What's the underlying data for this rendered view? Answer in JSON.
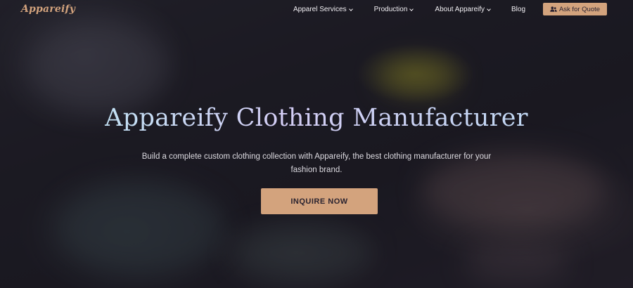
{
  "header": {
    "logo_text": "Appareify",
    "nav": [
      {
        "label": "Apparel Services",
        "has_dropdown": true
      },
      {
        "label": "Production",
        "has_dropdown": true
      },
      {
        "label": "About Appareify",
        "has_dropdown": true
      },
      {
        "label": "Blog",
        "has_dropdown": false
      }
    ],
    "quote_button": {
      "label": "Ask for Quote",
      "icon": "users-icon"
    }
  },
  "hero": {
    "title": "Appareify Clothing Manufacturer",
    "subtitle": "Build a complete custom clothing collection with Appareify, the best clothing manufacturer for your fashion brand.",
    "cta_label": "INQUIRE NOW"
  },
  "colors": {
    "accent": "#d3a37d",
    "background": "#1d1c24",
    "nav_text": "#f0eef2"
  }
}
